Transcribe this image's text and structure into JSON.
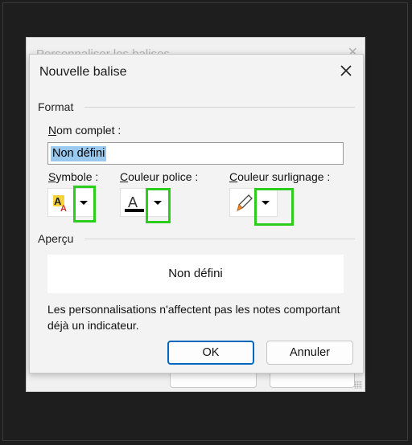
{
  "background_window": {
    "title": "Personnaliser les balises",
    "close_glyph": "✕"
  },
  "dialog": {
    "title": "Nouvelle balise",
    "close_glyph": "✕",
    "format_group": {
      "label": "Format",
      "name_label_accel": "N",
      "name_label_rest": "om complet :",
      "name_value": "Non défini",
      "symbol_label_accel": "S",
      "symbol_label_rest": "ymbole :",
      "font_color_label_accel": "C",
      "font_color_label_rest": "ouleur police :",
      "highlight_label_accel": "C",
      "highlight_label_rest": "ouleur surlignage :",
      "symbol_icon": "text-effects-icon",
      "font_color_icon": "font-color-icon",
      "highlight_icon": "highlighter-icon",
      "font_color": "#000000",
      "highlight_color": "#f28c28"
    },
    "preview_group": {
      "label": "Aperçu",
      "preview_text": "Non défini",
      "note": "Les personnalisations n'affectent pas les notes comportant déjà un indicateur."
    },
    "buttons": {
      "ok": "OK",
      "cancel": "Annuler"
    }
  },
  "colors": {
    "annotation_highlight": "#2ecc1e",
    "default_button_border": "#0067c0",
    "selection": "#99c9ef"
  }
}
